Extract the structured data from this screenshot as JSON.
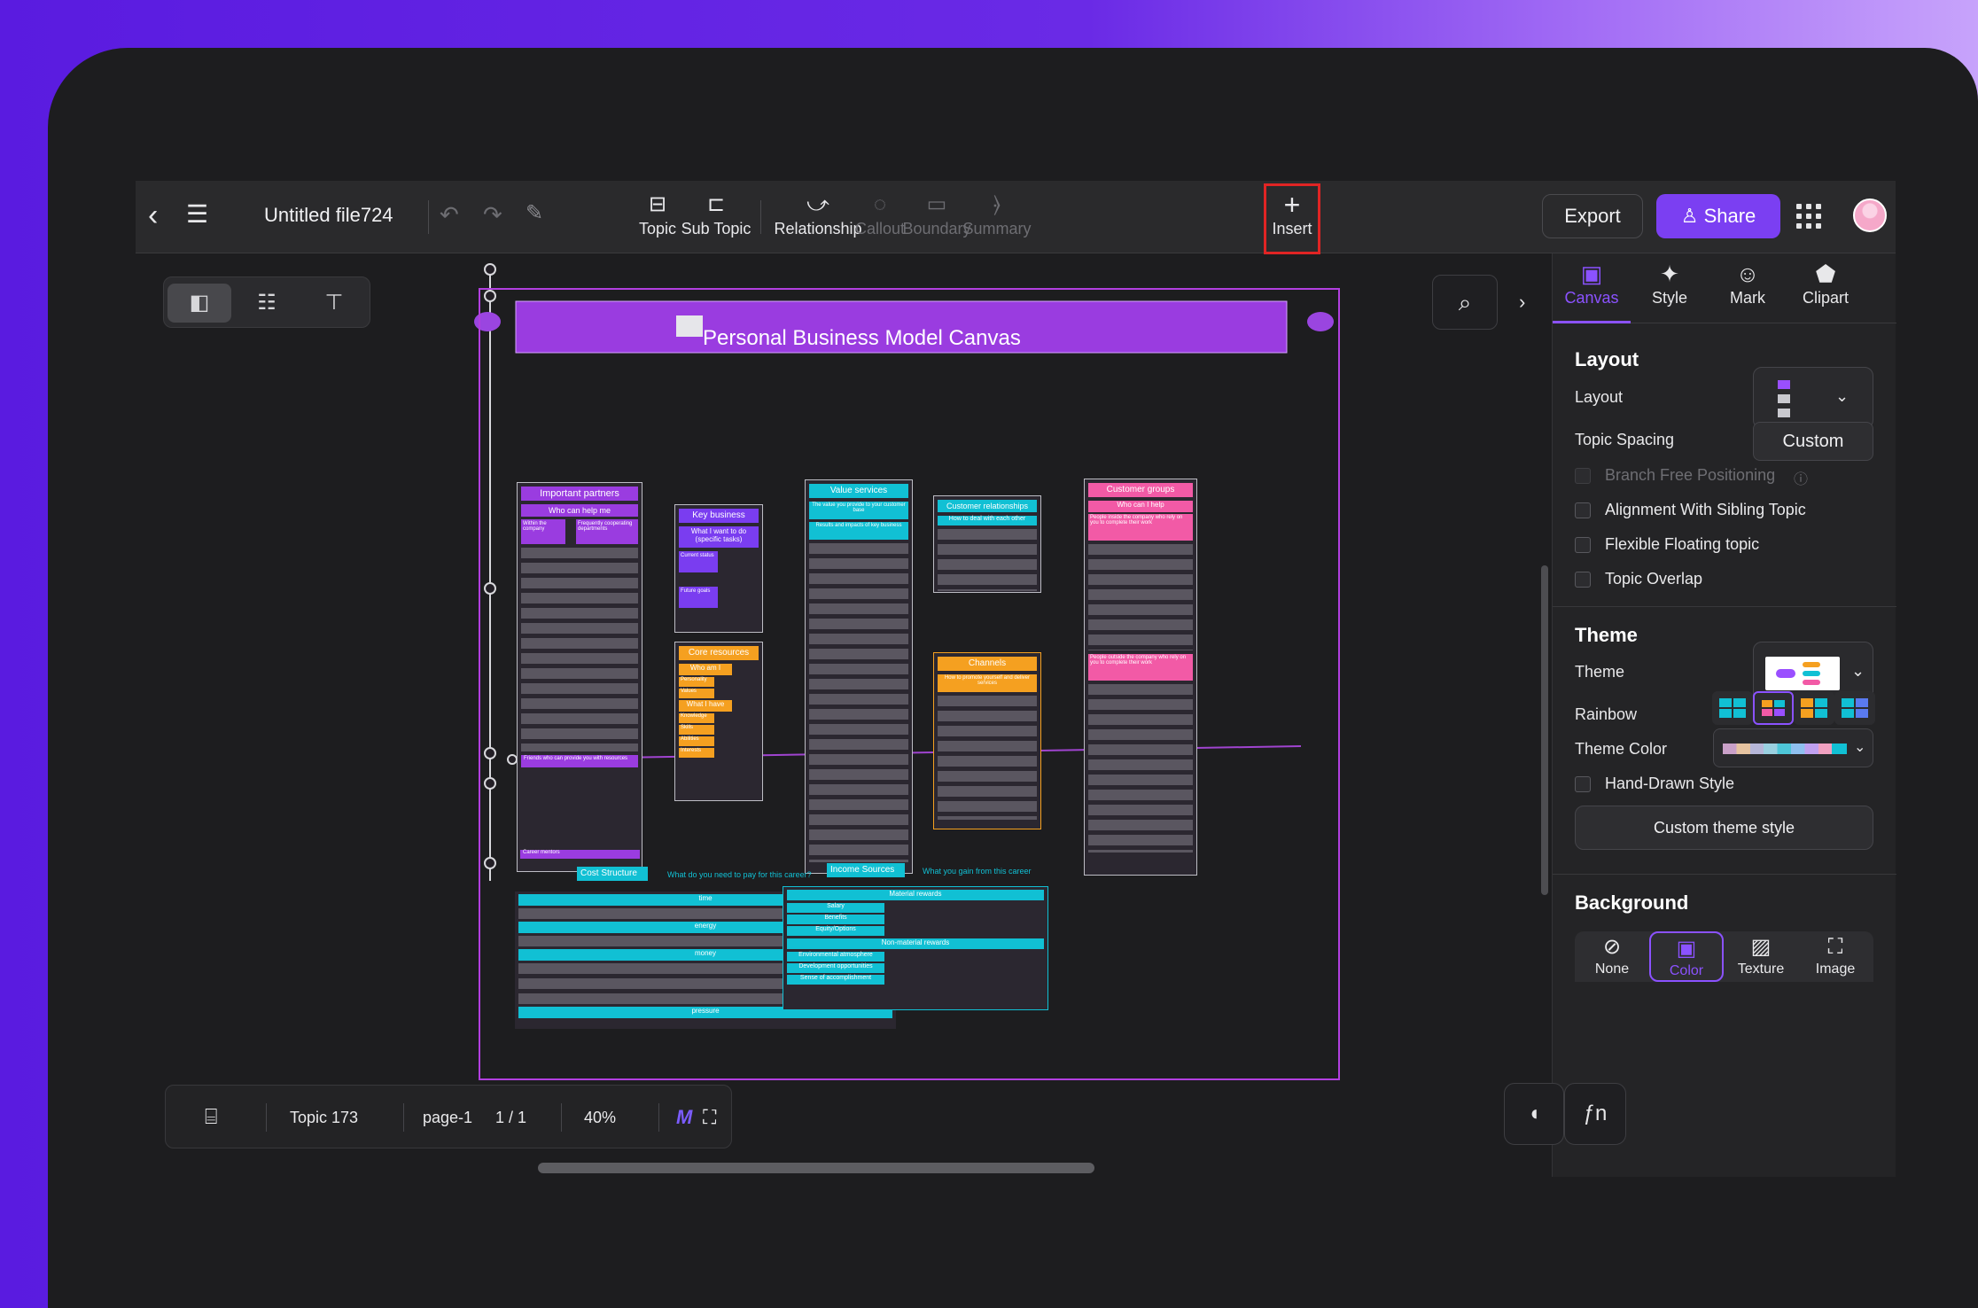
{
  "app": {
    "file_title": "Untitled file724"
  },
  "toolbar": {
    "tools": [
      {
        "label": "Topic",
        "enabled": true
      },
      {
        "label": "Sub Topic",
        "enabled": true
      },
      {
        "label": "Relationship",
        "enabled": true
      },
      {
        "label": "Callout",
        "enabled": false
      },
      {
        "label": "Boundary",
        "enabled": false
      },
      {
        "label": "Summary",
        "enabled": false
      },
      {
        "label": "Insert",
        "enabled": true,
        "highlighted": true
      }
    ],
    "export_label": "Export",
    "share_label": "Share"
  },
  "canvas": {
    "map_title": "Personal Business Model Canvas",
    "columns": [
      {
        "header": "Important partners",
        "items": [
          "Who can help me",
          "Within the company",
          "Frequently cooperating departments",
          "Friends who can provide you with resources",
          "Career mentors"
        ],
        "color": "#8e3de0"
      },
      {
        "header": "Key business",
        "items": [
          "What I want to do (specific tasks)",
          "Current status",
          "Future goals"
        ],
        "color": "#7a3df0"
      },
      {
        "header": "Core resources",
        "items": [
          "Who am I",
          "Personality",
          "Values",
          "What I have",
          "Knowledge",
          "Skills",
          "Abilities",
          "Interests"
        ],
        "color": "#f5a020"
      },
      {
        "header": "Value services",
        "items": [
          "The value you provide to your customer base",
          "Results and impacts of key business"
        ],
        "color": "#11c0d4"
      },
      {
        "header": "Customer relationships",
        "items": [
          "How to deal with each other"
        ],
        "color": "#11c0d4"
      },
      {
        "header": "Channels",
        "items": [
          "How to promote yourself and deliver services"
        ],
        "color": "#f5a020"
      },
      {
        "header": "Customer groups",
        "items": [
          "Who can I help",
          "People inside the company who rely on you to complete their work",
          "People outside the company who rely on you to complete their work"
        ],
        "color": "#f25aa6"
      }
    ],
    "cost_structure": {
      "header": "Cost Structure",
      "note": "What do you need to pay for this career?",
      "items": [
        "time",
        "energy",
        "money",
        "pressure"
      ]
    },
    "income_sources": {
      "header": "Income Sources",
      "note": "What you gain from this career",
      "groups": [
        {
          "label": "Material rewards",
          "items": [
            "Salary",
            "Benefits",
            "Equity/Options"
          ]
        },
        {
          "label": "Non-material rewards",
          "items": [
            "Environmental atmosphere",
            "Development opportunities",
            "Sense of accomplishment"
          ]
        }
      ]
    }
  },
  "panel": {
    "tabs": [
      {
        "label": "Canvas",
        "active": true
      },
      {
        "label": "Style"
      },
      {
        "label": "Mark"
      },
      {
        "label": "Clipart"
      }
    ],
    "layout_section": "Layout",
    "layout_label": "Layout",
    "topic_spacing_label": "Topic Spacing",
    "topic_spacing_value": "Custom",
    "checkboxes": [
      {
        "label": "Branch Free Positioning",
        "enabled": false,
        "checked": false
      },
      {
        "label": "Alignment With Sibling Topic",
        "enabled": true,
        "checked": false
      },
      {
        "label": "Flexible Floating topic",
        "enabled": true,
        "checked": false
      },
      {
        "label": "Topic Overlap",
        "enabled": true,
        "checked": false
      }
    ],
    "theme_section": "Theme",
    "theme_label": "Theme",
    "rainbow_label": "Rainbow",
    "theme_color_label": "Theme Color",
    "hand_drawn_label": "Hand-Drawn Style",
    "custom_theme_label": "Custom theme style",
    "background_section": "Background",
    "background_options": [
      "None",
      "Color",
      "Texture",
      "Image"
    ],
    "background_selected": "Color"
  },
  "bottombar": {
    "topic_count": "Topic 173",
    "page": "page-1",
    "page_count": "1 / 1",
    "zoom": "40%"
  },
  "colors": {
    "accent": "#7b3ff2",
    "canvas_border": "#b23fe0",
    "highlight": "#e02424"
  }
}
